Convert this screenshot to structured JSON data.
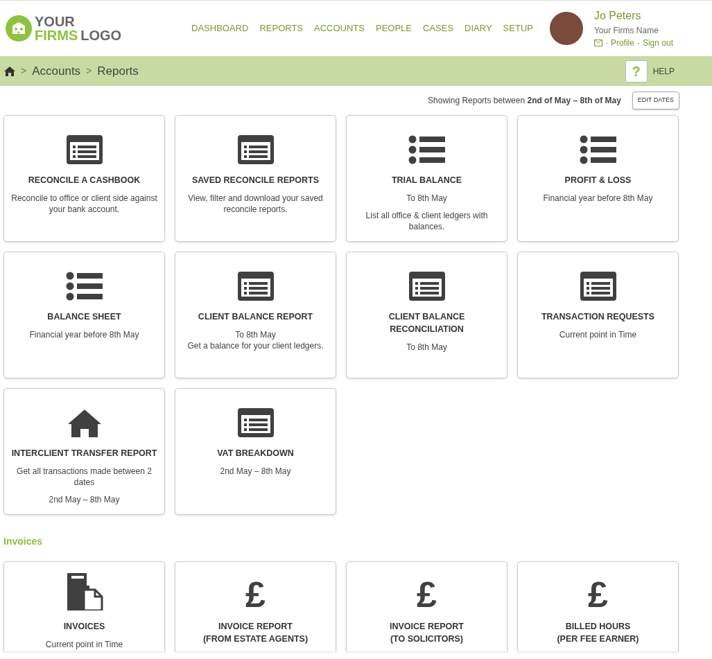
{
  "logo": {
    "line1": "YOUR",
    "accent": "FIRMS",
    "rest": "LOGO"
  },
  "nav": [
    {
      "label": "DASHBOARD",
      "selected": false
    },
    {
      "label": "REPORTS",
      "selected": false
    },
    {
      "label": "ACCOUNTS",
      "selected": false
    },
    {
      "label": "PEOPLE",
      "selected": false
    },
    {
      "label": "CASES",
      "selected": false
    },
    {
      "label": "DIARY",
      "selected": false
    },
    {
      "label": "SETUP",
      "selected": false
    }
  ],
  "user": {
    "name": "Jo Peters",
    "firm": "Your Firms Name",
    "links": [
      "Profile",
      "Sign out"
    ],
    "separator": "·"
  },
  "breadcrumb": {
    "items": [
      "Accounts",
      "Reports"
    ],
    "separator": ">"
  },
  "help": {
    "symbol": "?",
    "label": "HELP"
  },
  "range": {
    "text": "Showing Reports between **2nd of May – 8th of May**",
    "button": "EDIT DATES"
  },
  "sections": [
    {
      "cards": [
        {
          "kind": "window-list",
          "title": "RECONCILE A CASHBOOK",
          "paragraphs": [
            "Reconcile to office or client side against your bank account."
          ]
        },
        {
          "kind": "window-list",
          "title": "SAVED RECONCILE REPORTS",
          "paragraphs": [
            "View, filter and download your saved reconcile reports."
          ]
        },
        {
          "kind": "bullet-list",
          "title": "TRIAL BALANCE",
          "paragraphs": [
            "To 8th May",
            "List all office & client ledgers with balances."
          ]
        },
        {
          "kind": "bullet-list",
          "title": "PROFIT & LOSS",
          "paragraphs": [
            "Financial year before 8th May"
          ]
        },
        {
          "kind": "bullet-list",
          "title": "BALANCE SHEET",
          "paragraphs": [
            "Financial year before 8th May"
          ]
        },
        {
          "kind": "window-list",
          "title": "CLIENT BALANCE REPORT",
          "paragraphs": [
            "To 8th May\nGet a balance for your client ledgers."
          ]
        },
        {
          "kind": "window-list",
          "title": "CLIENT BALANCE RECONCILIATION",
          "paragraphs": [
            "To 8th May"
          ]
        },
        {
          "kind": "window-list",
          "title": "TRANSACTION REQUESTS",
          "paragraphs": [
            "Current point in Time"
          ]
        },
        {
          "kind": "house",
          "title": "INTERCLIENT TRANSFER REPORT",
          "paragraphs": [
            "Get all transactions made between 2 dates",
            "2nd May  –  8th May"
          ]
        },
        {
          "kind": "window-list",
          "title": "VAT BREAKDOWN",
          "paragraphs": [
            "2nd May  –  8th May"
          ]
        }
      ]
    },
    {
      "heading": "Invoices",
      "cards": [
        {
          "kind": "documents",
          "title": "INVOICES",
          "paragraphs": [
            "Current point in Time"
          ]
        },
        {
          "kind": "symbol",
          "symbol": "£",
          "title": "INVOICE REPORT\n(FROM ESTATE AGENTS)"
        },
        {
          "kind": "symbol",
          "symbol": "£",
          "title": "INVOICE REPORT\n(TO SOLICITORS)"
        },
        {
          "kind": "symbol",
          "symbol": "£",
          "title": "BILLED HOURS\n(PER FEE EARNER)"
        }
      ]
    }
  ]
}
